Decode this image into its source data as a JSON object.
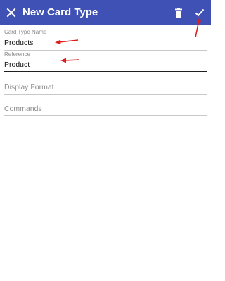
{
  "toolbar": {
    "title": "New Card Type",
    "close_icon": "close-icon",
    "delete_icon": "trash-icon",
    "save_icon": "checkmark-icon",
    "background": "#3f51b5"
  },
  "form": {
    "card_type_name": {
      "label": "Card Type Name",
      "value": "Products"
    },
    "reference": {
      "label": "Reference",
      "value": "Product"
    },
    "display_format": {
      "placeholder": "Display Format",
      "value": ""
    },
    "commands": {
      "placeholder": "Commands",
      "value": ""
    }
  },
  "annotations": {
    "arrow_color": "#d9201e"
  }
}
